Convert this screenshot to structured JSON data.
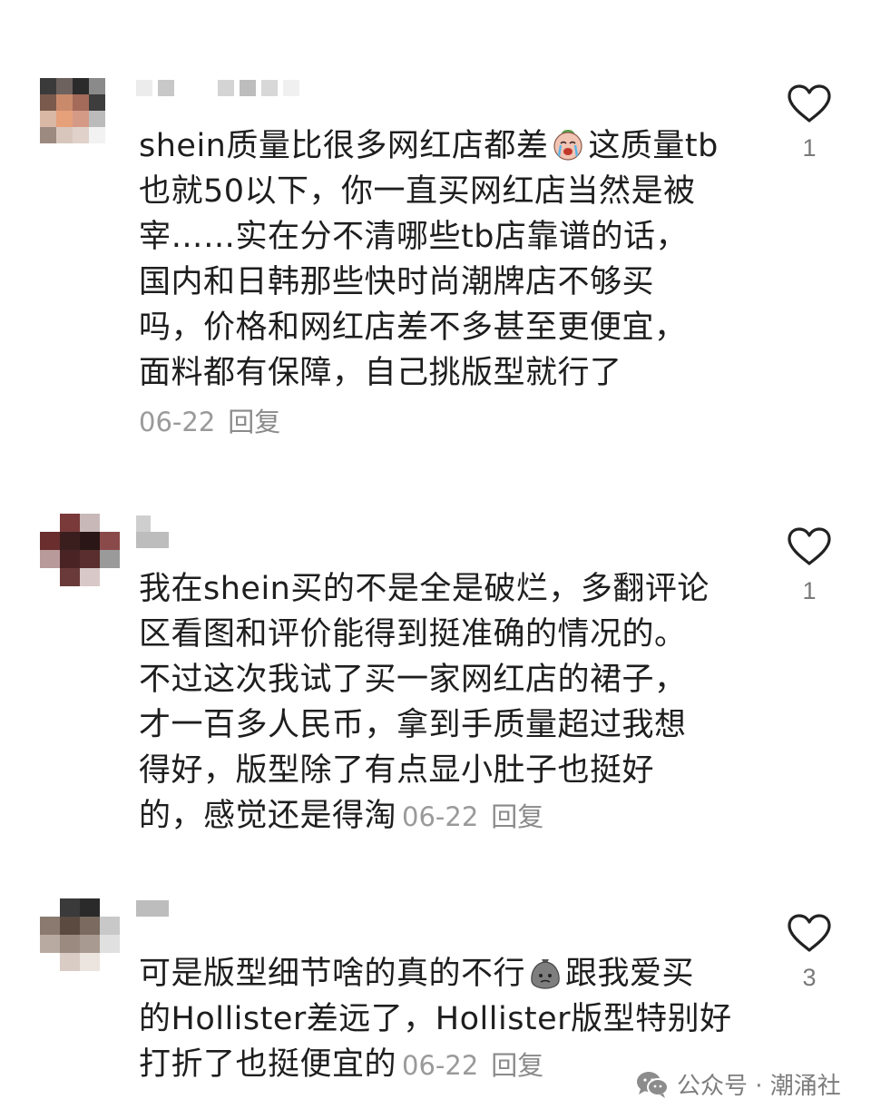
{
  "comments": [
    {
      "lines": [
        "shein质量比很多网红店都差",
        "这质量tb",
        "也就50以下，你一直买网红店当然是被",
        "宰……实在分不清哪些tb店靠谱的话，",
        "国内和日韩那些快时尚潮牌店不够买",
        "吗，价格和网红店差不多甚至更便宜，",
        "面料都有保障，自己挑版型就行了"
      ],
      "date": "06-22",
      "reply_label": "回复",
      "like_count": "1",
      "emoji_icon": "crying-face-icon"
    },
    {
      "lines": [
        "我在shein买的不是全是破烂，多翻评论",
        "区看图和评价能得到挺准确的情况的。",
        "不过这次我试了买一家网红店的裙子，",
        "才一百多人民币，拿到手质量超过我想",
        "得好，版型除了有点显小肚子也挺好",
        "的，感觉还是得淘"
      ],
      "date": "06-22",
      "reply_label": "回复",
      "like_count": "1"
    },
    {
      "lines": [
        "可是版型细节啥的真的不行",
        "跟我爱买",
        "的Hollister差远了，Hollister版型特别好",
        "打折了也挺便宜的"
      ],
      "date": "06-22",
      "reply_label": "回复",
      "like_count": "3",
      "emoji_icon": "sack-face-icon"
    }
  ],
  "watermark": {
    "text": "公众号 · 潮涌社",
    "icon": "wechat-icon"
  },
  "colors": {
    "text": "#1e1e1e",
    "meta": "#9a9a9a",
    "like_outline": "#222222"
  }
}
